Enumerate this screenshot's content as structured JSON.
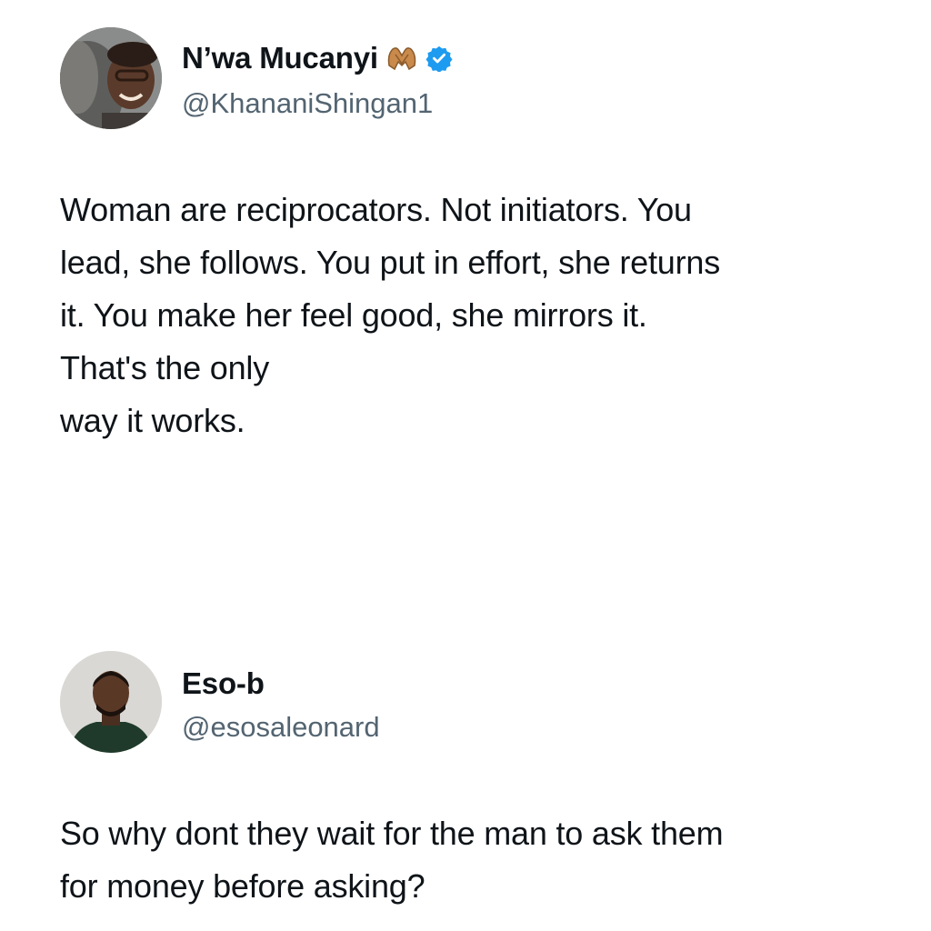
{
  "tweets": [
    {
      "display_name": "N’wa Mucanyi",
      "handle": "@KhananiShingan1",
      "verified": true,
      "name_emoji": "heart-hands-emoji",
      "text_lines": [
        "Woman are reciprocators. Not initiators. You",
        "lead, she follows. You put in effort, she returns",
        "it. You make her feel good, she mirrors it.",
        "That's the only",
        "way it works."
      ]
    },
    {
      "display_name": "Eso-b",
      "handle": "@esosaleonard",
      "verified": false,
      "text_lines": [
        "So why dont they wait for the man to ask them",
        "for money before asking?"
      ]
    }
  ],
  "colors": {
    "text": "#0f1419",
    "secondary_text": "#536471",
    "verified_blue": "#1d9bf0"
  }
}
